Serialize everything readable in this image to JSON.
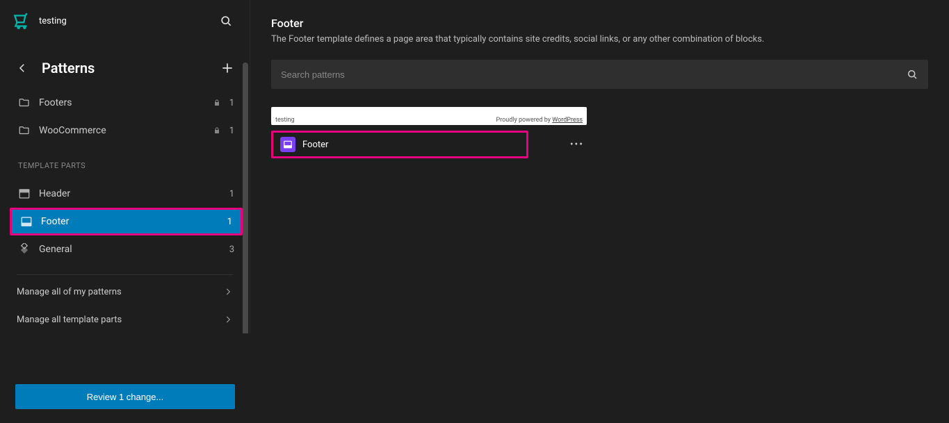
{
  "site": {
    "name": "testing"
  },
  "sidebar": {
    "title": "Patterns",
    "categories": [
      {
        "label": "Footers",
        "count": "1",
        "locked": true
      },
      {
        "label": "WooCommerce",
        "count": "1",
        "locked": true
      }
    ],
    "template_parts_label": "TEMPLATE PARTS",
    "template_parts": [
      {
        "label": "Header",
        "count": "1",
        "icon": "header"
      },
      {
        "label": "Footer",
        "count": "1",
        "icon": "footer",
        "active": true
      },
      {
        "label": "General",
        "count": "3",
        "icon": "general"
      }
    ],
    "manage_patterns": "Manage all of my patterns",
    "manage_parts": "Manage all template parts",
    "review_button": "Review 1 change..."
  },
  "main": {
    "title": "Footer",
    "description": "The Footer template defines a page area that typically contains site credits, social links, or any other combination of blocks.",
    "search_placeholder": "Search patterns",
    "preview": {
      "left": "testing",
      "right_prefix": "Proudly powered by ",
      "right_link": "WordPress"
    },
    "card": {
      "name": "Footer"
    }
  }
}
